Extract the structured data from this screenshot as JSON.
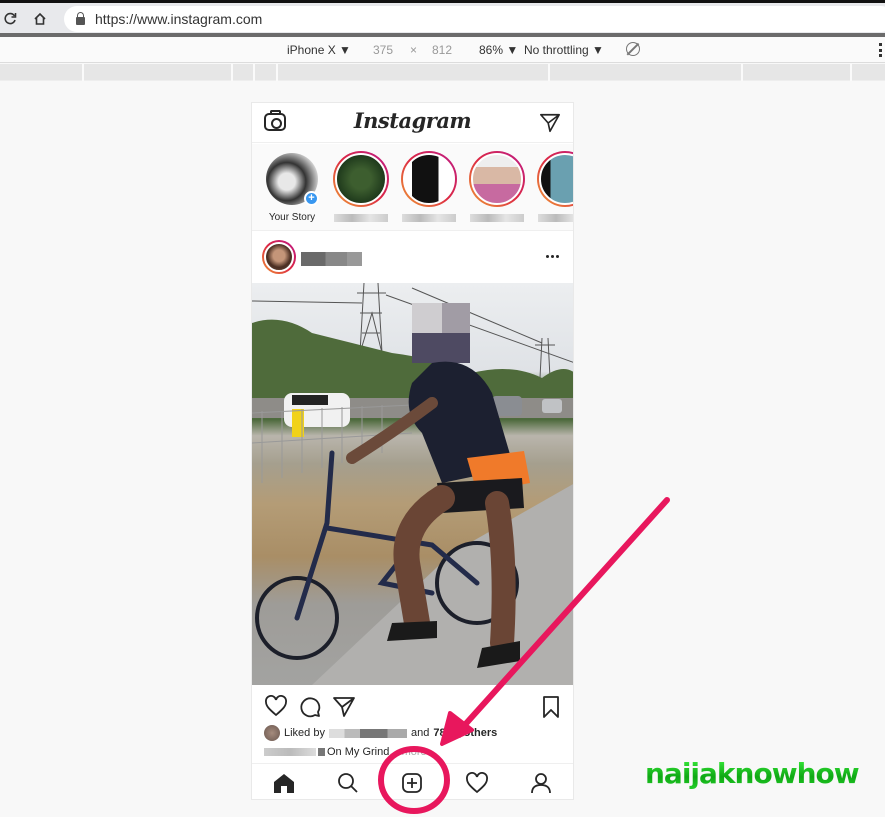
{
  "browser": {
    "url": "https://www.instagram.com",
    "reload_icon": "reload-icon",
    "home_icon": "home-icon",
    "lock_icon": "lock-icon"
  },
  "devtools": {
    "device": "iPhone X ▼",
    "width": "375",
    "times": "×",
    "height": "812",
    "zoom": "86% ▼",
    "throttling": "No throttling ▼",
    "rotate_icon": "rotate-icon",
    "menu_icon": "kebab-menu-icon"
  },
  "instagram": {
    "header": {
      "logo": "Instagram",
      "camera_icon": "camera-icon",
      "direct_icon": "paper-plane-icon"
    },
    "stories": [
      {
        "label": "Your Story",
        "own": true,
        "colors": [
          "#222",
          "#eee"
        ]
      },
      {
        "label": "",
        "own": false,
        "colors": [
          "#1f3a1c",
          "#3d5e2f"
        ]
      },
      {
        "label": "",
        "own": false,
        "colors": [
          "#111",
          "#fff"
        ]
      },
      {
        "label": "",
        "own": false,
        "colors": [
          "#d9b8a5",
          "#c76aa0"
        ]
      },
      {
        "label": "",
        "own": false,
        "colors": [
          "#6aa0b0",
          "#d94040"
        ]
      }
    ],
    "post": {
      "more_icon": "more-options-icon",
      "likes_prefix": "Liked by",
      "likes_and": "and",
      "likes_count_partial": "78",
      "likes_suffix": "others",
      "caption_text": "On My Grind",
      "caption_more": "... more"
    },
    "actions": [
      "heart-icon",
      "comment-icon",
      "share-icon",
      "bookmark-icon"
    ],
    "bottom_nav": [
      "home-tab",
      "search-tab",
      "new-post-tab",
      "activity-tab",
      "profile-tab"
    ]
  },
  "annotation": {
    "highlight_color": "#e8175d",
    "target": "new-post-tab"
  },
  "watermark": {
    "text": "naijaknowhow",
    "color": "#23d12a"
  }
}
